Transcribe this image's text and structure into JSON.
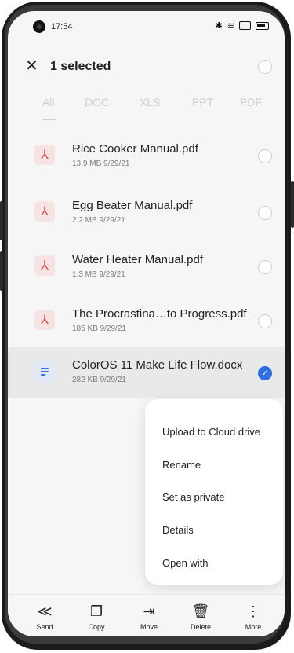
{
  "status": {
    "time": "17:54"
  },
  "header": {
    "title": "1 selected"
  },
  "tabs": [
    "All",
    "DOC",
    "XLS",
    "PPT",
    "PDF"
  ],
  "files": [
    {
      "name": "Rice Cooker Manual.pdf",
      "meta": "13.9 MB  9/29/21",
      "type": "pdf",
      "selected": false
    },
    {
      "name": "Egg Beater Manual.pdf",
      "meta": "2.2 MB  9/29/21",
      "type": "pdf",
      "selected": false
    },
    {
      "name": "Water Heater Manual.pdf",
      "meta": "1.3 MB  9/29/21",
      "type": "pdf",
      "selected": false
    },
    {
      "name": "The Procrastina…to Progress.pdf",
      "meta": "185 KB  9/29/21",
      "type": "pdf",
      "selected": false
    },
    {
      "name": "ColorOS 11 Make Life Flow.docx",
      "meta": "282 KB  9/29/21",
      "type": "doc",
      "selected": true
    }
  ],
  "menu": [
    "Upload to Cloud drive",
    "Rename",
    "Set as private",
    "Details",
    "Open with"
  ],
  "toolbar": {
    "send": "Send",
    "copy": "Copy",
    "move": "Move",
    "delete": "Delete",
    "more": "More"
  },
  "colors": {
    "accent": "#2f6fe4",
    "pdf": "#d9534f",
    "selected_row": "#e9e9e9"
  }
}
